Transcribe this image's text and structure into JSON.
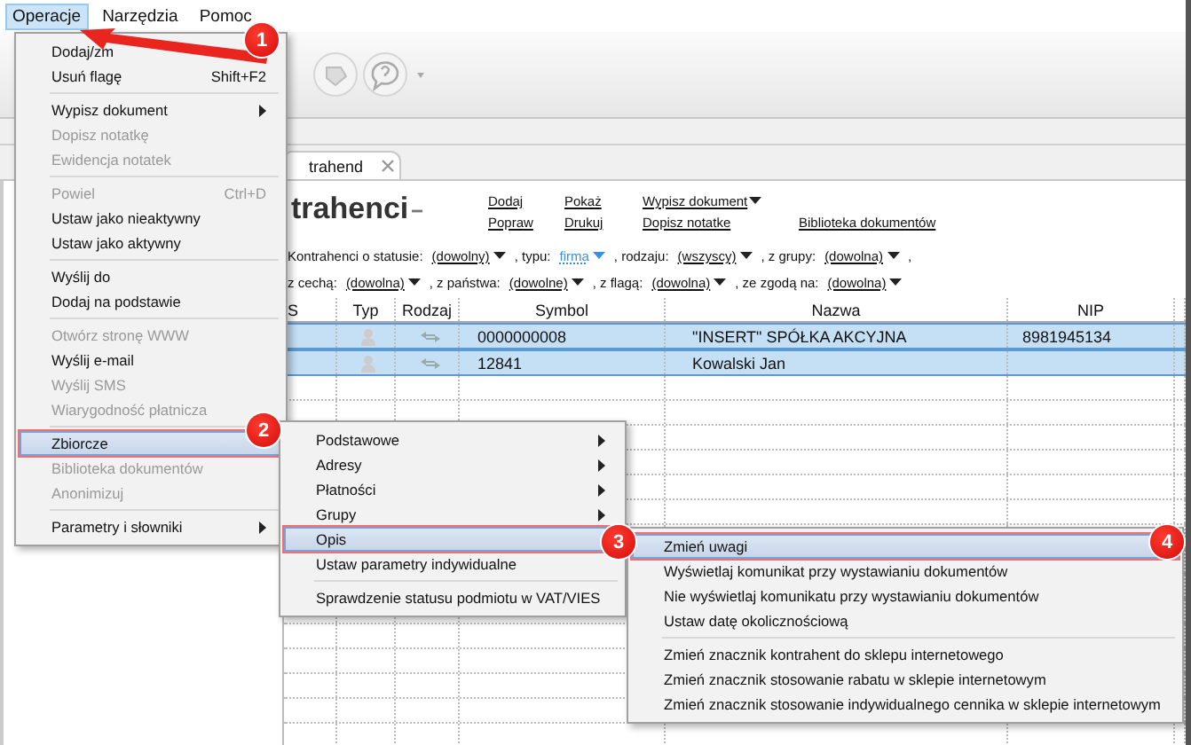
{
  "menubar": [
    {
      "label": "Operacje",
      "selected": true
    },
    {
      "label": "Narzędzia",
      "selected": false
    },
    {
      "label": "Pomoc",
      "selected": false
    }
  ],
  "tab": {
    "label": "trahend"
  },
  "header": {
    "title": "trahenci"
  },
  "actions": {
    "top": [
      {
        "label": "Dodaj",
        "dropdown": false
      },
      {
        "label": "Pokaż",
        "dropdown": false
      },
      {
        "label": "Wypisz dokument",
        "dropdown": true
      }
    ],
    "bottom": [
      {
        "label": "Popraw",
        "dropdown": false
      },
      {
        "label": "Drukuj",
        "dropdown": false
      },
      {
        "label": "Dopisz notatke",
        "dropdown": false
      },
      {
        "label": "Biblioteka dokumentów",
        "dropdown": false
      }
    ]
  },
  "filters": [
    {
      "items": [
        {
          "label": "Kontrahenci o statusie:",
          "value": "(dowolny)",
          "highlighted": false
        },
        {
          "label": ", typu:",
          "value": "firma",
          "highlighted": true
        },
        {
          "label": ", rodzaju:",
          "value": "(wszyscy)",
          "highlighted": false
        },
        {
          "label": ", z grupy:",
          "value": "(dowolna)",
          "highlighted": false
        }
      ],
      "trailing": ","
    },
    {
      "items": [
        {
          "label": "z cechą:",
          "value": "(dowolna)",
          "highlighted": false
        },
        {
          "label": ", z państwa:",
          "value": "(dowolne)",
          "highlighted": false
        },
        {
          "label": ", z flagą:",
          "value": "(dowolna)",
          "highlighted": false
        },
        {
          "label": ", ze zgodą na:",
          "value": "(dowolna)",
          "highlighted": false
        }
      ]
    }
  ],
  "table": {
    "columns": [
      "S",
      "Typ",
      "Rodzaj",
      "Symbol",
      "Nazwa",
      "NIP"
    ],
    "rows": [
      {
        "symbol": "0000000008",
        "name": "\"INSERT\" SPÓŁKA AKCYJNA",
        "nip": "8981945134",
        "selected": true
      },
      {
        "symbol": "12841",
        "name": "Kowalski Jan",
        "selected": true
      }
    ]
  },
  "menus": [
    {
      "groups": [
        [
          {
            "label": "Dodaj/zm",
            "disabled": false,
            "selected": false
          },
          {
            "label": "Usuń flagę",
            "shortcut": "Shift+F2",
            "disabled": false,
            "selected": false
          }
        ],
        [
          {
            "label": "Wypisz dokument",
            "disabled": false,
            "submenu": true,
            "selected": false
          },
          {
            "label": "Dopisz notatkę",
            "disabled": true,
            "selected": false
          },
          {
            "label": "Ewidencja notatek",
            "disabled": true,
            "selected": false
          }
        ],
        [
          {
            "label": "Powiel",
            "shortcut": "Ctrl+D",
            "disabled": true,
            "selected": false
          },
          {
            "label": "Ustaw jako nieaktywny",
            "disabled": false,
            "selected": false
          },
          {
            "label": "Ustaw jako aktywny",
            "disabled": false,
            "selected": false
          }
        ],
        [
          {
            "label": "Wyślij do",
            "disabled": false,
            "selected": false
          },
          {
            "label": "Dodaj na podstawie",
            "disabled": false,
            "selected": false
          }
        ],
        [
          {
            "label": "Otwórz stronę WWW",
            "disabled": true,
            "selected": false
          },
          {
            "label": "Wyślij e-mail",
            "disabled": false,
            "selected": false
          },
          {
            "label": "Wyślij SMS",
            "disabled": true,
            "selected": false
          },
          {
            "label": "Wiarygodność płatnicza",
            "disabled": true,
            "selected": false
          }
        ],
        [
          {
            "label": "Zbiorcze",
            "disabled": false,
            "selected": true
          },
          {
            "label": "Biblioteka dokumentów",
            "disabled": true,
            "selected": false
          },
          {
            "label": "Anonimizuj",
            "disabled": true,
            "selected": false
          }
        ],
        [
          {
            "label": "Parametry i słowniki",
            "disabled": false,
            "submenu": true,
            "selected": false
          }
        ]
      ]
    },
    {
      "groups": [
        [
          {
            "label": "Podstawowe",
            "disabled": false,
            "submenu": true,
            "selected": false
          },
          {
            "label": "Adresy",
            "disabled": false,
            "submenu": true,
            "selected": false
          },
          {
            "label": "Płatności",
            "disabled": false,
            "submenu": true,
            "selected": false
          },
          {
            "label": "Grupy",
            "disabled": false,
            "submenu": true,
            "selected": false
          },
          {
            "label": "Opis",
            "disabled": false,
            "selected": true
          },
          {
            "label": "Ustaw parametry indywidualne",
            "disabled": false,
            "selected": false
          }
        ],
        [
          {
            "label": "Sprawdzenie statusu podmiotu w VAT/VIES",
            "disabled": false,
            "selected": false
          }
        ]
      ]
    },
    {
      "groups": [
        [
          {
            "label": "Zmień uwagi",
            "disabled": false,
            "selected": true
          },
          {
            "label": "Wyświetlaj komunikat przy wystawianiu dokumentów",
            "disabled": false,
            "selected": false
          },
          {
            "label": "Nie wyświetlaj komunikatu przy wystawianiu dokumentów",
            "disabled": false,
            "selected": false
          },
          {
            "label": "Ustaw datę okolicznościową",
            "disabled": false,
            "selected": false
          }
        ],
        [
          {
            "label": "Zmień znacznik kontrahent do sklepu internetowego",
            "disabled": false,
            "selected": false
          },
          {
            "label": "Zmień znacznik stosowanie rabatu w sklepie internetowym",
            "disabled": false,
            "selected": false
          },
          {
            "label": "Zmień znacznik stosowanie indywidualnego cennika w sklepie internetowym",
            "disabled": false,
            "selected": false
          }
        ]
      ]
    }
  ],
  "callouts": [
    {
      "number": "1"
    },
    {
      "number": "2"
    },
    {
      "number": "3"
    },
    {
      "number": "4"
    }
  ]
}
